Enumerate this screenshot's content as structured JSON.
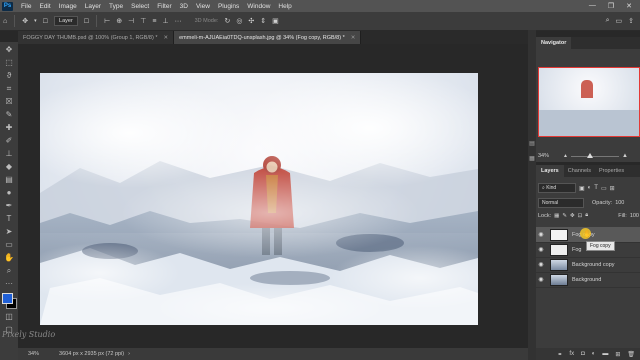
{
  "menu": [
    "File",
    "Edit",
    "Image",
    "Layer",
    "Type",
    "Select",
    "Filter",
    "3D",
    "View",
    "Plugins",
    "Window",
    "Help"
  ],
  "options": {
    "layer_select": "Layer",
    "mode_3d": "3D Mode:"
  },
  "tabs": [
    {
      "label": "FOGGY DAY THUMB.psd @ 100% (Group 1, RGB/8) *"
    },
    {
      "label": "emmeli-m-AJUAEia0TDQ-unsplash.jpg @ 34% (Fog copy, RGB/8) *"
    }
  ],
  "status": {
    "zoom": "34%",
    "doc_size": "3604 px x 2935 px (72 ppi)"
  },
  "watermark": "Pixely Studio",
  "navigator": {
    "title": "Navigator",
    "zoom": "34%"
  },
  "layers_panel": {
    "tabs": [
      "Layers",
      "Channels",
      "Properties"
    ],
    "kind": "Kind",
    "blend": "Normal",
    "opacity_label": "Opacity:",
    "opacity_value": "100",
    "lock_label": "Lock:",
    "fill_label": "Fill:",
    "fill_value": "100",
    "layers": [
      {
        "name": "Fog copy",
        "selected": true
      },
      {
        "name": "Fog",
        "selected": false
      },
      {
        "name": "Background copy",
        "selected": false
      },
      {
        "name": "Background",
        "selected": false
      }
    ],
    "drag_tooltip": "Fog copy",
    "bottom_icons": [
      "link-icon",
      "fx-icon",
      "mask-icon",
      "adjustment-icon",
      "folder-icon",
      "new-layer-icon",
      "trash-icon"
    ]
  },
  "colors": {
    "accent": "#31a8ff",
    "foreground": "#1f5fd6",
    "background": "#000000",
    "jacket": "#c0392b"
  }
}
